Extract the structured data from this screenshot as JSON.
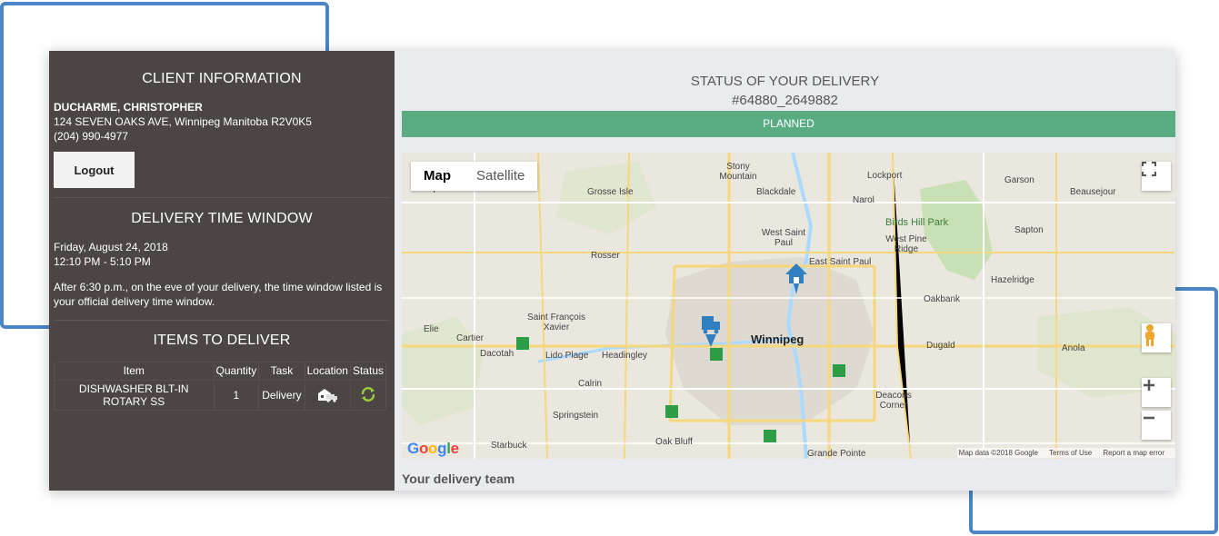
{
  "client": {
    "title": "CLIENT INFORMATION",
    "name": "DUCHARME, CHRISTOPHER",
    "address": "124 SEVEN OAKS AVE, Winnipeg Manitoba R2V0K5",
    "phone": "(204) 990-4977",
    "logout_label": "Logout"
  },
  "delivery_window": {
    "title": "DELIVERY TIME WINDOW",
    "date": "Friday, August 24, 2018",
    "time": "12:10 PM - 5:10 PM",
    "note": "After 6:30 p.m., on the eve of your delivery, the time window listed is your official delivery time window."
  },
  "items": {
    "title": "ITEMS TO DELIVER",
    "columns": [
      "Item",
      "Quantity",
      "Task",
      "Location",
      "Status"
    ],
    "rows": [
      {
        "item": "DISHWASHER BLT-IN ROTARY SS",
        "quantity": "1",
        "task": "Delivery",
        "location_icon": "truck-house-icon",
        "status_icon": "refresh-icon"
      }
    ]
  },
  "status": {
    "title": "STATUS OF YOUR DELIVERY",
    "order_id": "#64880_2649882",
    "state": "PLANNED",
    "state_color": "#5aad83"
  },
  "map": {
    "type_buttons": [
      "Map",
      "Satellite"
    ],
    "active_type": "Map",
    "logo": "Google",
    "attribution": [
      "Map data ©2018 Google",
      "Terms of Use",
      "Report a map error"
    ],
    "labels": {
      "marquette": "Marquette",
      "grosse_isle": "Grosse Isle",
      "stony_mountain": "Stony Mountain",
      "blackdale": "Blackdale",
      "lockport": "Lockport",
      "garson": "Garson",
      "beausejour": "Beausejour",
      "narol": "Narol",
      "birds_hill_park": "Birds Hill Park",
      "west_st_paul": "West Saint Paul",
      "west_pine_ridge": "West Pine Ridge",
      "sapton": "Sapton",
      "rosser": "Rosser",
      "east_st_paul": "East Saint Paul",
      "hazelridge": "Hazelridge",
      "oakbank": "Oakbank",
      "st_francois_xavier": "Saint François Xavier",
      "elie": "Elie",
      "cartier": "Cartier",
      "dacotah": "Dacotah",
      "lido_plage": "Lido Plage",
      "headingley": "Headingley",
      "winnipeg": "Winnipeg",
      "dugald": "Dugald",
      "anola": "Anola",
      "calrin": "Calrin",
      "springstein": "Springstein",
      "deacons_corner": "Deacons Corner",
      "starbuck": "Starbuck",
      "oak_bluff": "Oak Bluff",
      "grande_pointe": "Grande Pointe"
    },
    "markers": [
      "home-marker-icon",
      "truck-marker-icon"
    ]
  },
  "footer": {
    "team_label": "Your delivery team"
  },
  "colors": {
    "sidebar_bg": "#4b4543",
    "accent_blue": "#4a86c4",
    "planned_green": "#5aad83"
  }
}
